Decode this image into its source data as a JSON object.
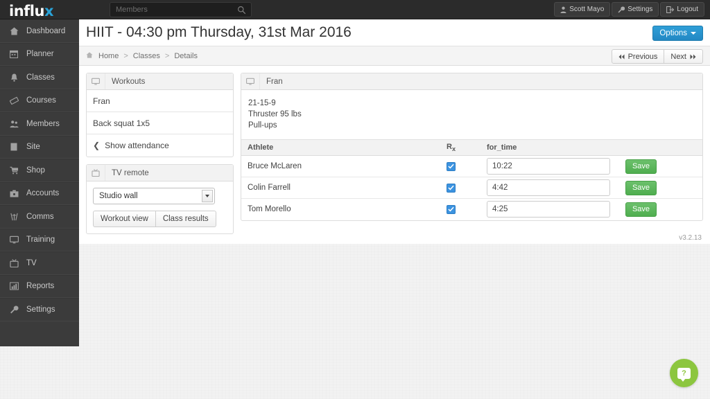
{
  "brand": {
    "name_main": "influ",
    "name_accent": "x"
  },
  "search": {
    "placeholder": "Members",
    "value": "",
    "icon": "search-icon"
  },
  "topnav": [
    {
      "label": "Scott Mayo",
      "icon": "user-icon"
    },
    {
      "label": "Settings",
      "icon": "wrench-icon"
    },
    {
      "label": "Logout",
      "icon": "logout-icon"
    }
  ],
  "sidebar": {
    "items": [
      {
        "label": "Dashboard",
        "icon": "home-icon"
      },
      {
        "label": "Planner",
        "icon": "calendar-icon"
      },
      {
        "label": "Classes",
        "icon": "bell-icon"
      },
      {
        "label": "Courses",
        "icon": "ticket-icon"
      },
      {
        "label": "Members",
        "icon": "people-icon"
      },
      {
        "label": "Site",
        "icon": "page-icon"
      },
      {
        "label": "Shop",
        "icon": "cart-icon"
      },
      {
        "label": "Accounts",
        "icon": "wallet-icon"
      },
      {
        "label": "Comms",
        "icon": "broadcast-icon"
      },
      {
        "label": "Training",
        "icon": "monitor-icon"
      },
      {
        "label": "TV",
        "icon": "tv-icon"
      },
      {
        "label": "Reports",
        "icon": "chart-icon"
      },
      {
        "label": "Settings",
        "icon": "wrench-icon"
      }
    ]
  },
  "header": {
    "title": "HIIT - 04:30 pm Thursday, 31st Mar 2016",
    "options_label": "Options"
  },
  "breadcrumb": {
    "home": "Home",
    "separator": ">",
    "items": [
      "Classes",
      "Details"
    ]
  },
  "pager": {
    "previous": "Previous",
    "next": "Next"
  },
  "workouts_panel": {
    "title": "Workouts",
    "icon": "monitor-icon",
    "rows": [
      "Fran",
      "Back squat 1x5"
    ],
    "attendance_label": "Show attendance"
  },
  "tv_remote_panel": {
    "title": "TV remote",
    "icon": "tv-icon",
    "select_value": "Studio wall",
    "buttons": [
      "Workout view",
      "Class results"
    ]
  },
  "workout_panel": {
    "title": "Fran",
    "icon": "monitor-icon",
    "description_lines": [
      "21-15-9",
      "Thruster 95 lbs",
      "Pull-ups"
    ],
    "columns": {
      "athlete": "Athlete",
      "rx": "R",
      "rx_sub": "x",
      "score": "for_time",
      "action": ""
    },
    "rows": [
      {
        "athlete": "Bruce McLaren",
        "rx": true,
        "score": "10:22",
        "save_label": "Save"
      },
      {
        "athlete": "Colin Farrell",
        "rx": true,
        "score": "4:42",
        "save_label": "Save"
      },
      {
        "athlete": "Tom Morello",
        "rx": true,
        "score": "4:25",
        "save_label": "Save"
      }
    ]
  },
  "version": "v3.2.13",
  "help": {
    "glyph": "?"
  },
  "colors": {
    "accent_blue": "#2388c4",
    "save_green": "#4fae4f",
    "help_green": "#8cc63f",
    "logo_blue": "#2aa3d8",
    "sidebar_bg": "#3b3b3b",
    "topbar_bg": "#2b2b2b"
  }
}
